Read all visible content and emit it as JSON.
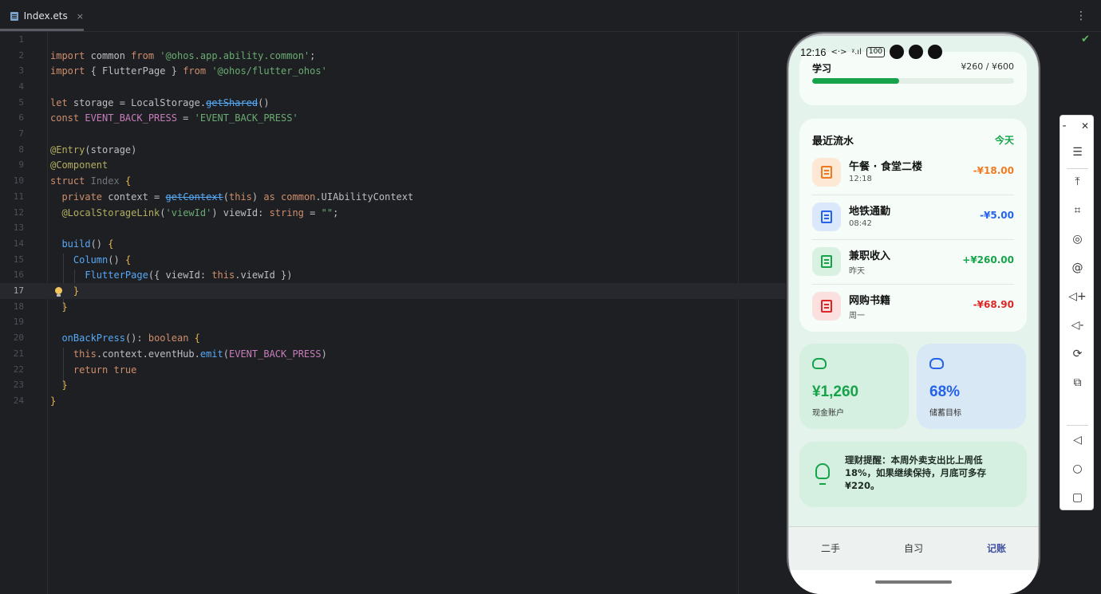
{
  "editor": {
    "tab_name": "Index.ets",
    "tab_close": "×",
    "menu_glyph": "⋮",
    "active_line": 17,
    "line_numbers": [
      "1",
      "2",
      "3",
      "4",
      "5",
      "6",
      "7",
      "8",
      "9",
      "10",
      "11",
      "12",
      "13",
      "14",
      "15",
      "16",
      "17",
      "18",
      "19",
      "20",
      "21",
      "22",
      "23",
      "24"
    ]
  },
  "phone": {
    "status": {
      "time": "12:16",
      "network": "<·>",
      "signal": "ᵡ.ıl",
      "battery": "100"
    },
    "budget": {
      "label": "学习",
      "value": "¥260 / ¥600",
      "progress": 0.43
    },
    "transactions": {
      "title": "最近流水",
      "filter": "今天",
      "items": [
        {
          "name": "午餐 · 食堂二楼",
          "sub": "12:18",
          "amount": "-¥18.00",
          "color": "#f07a20",
          "bg": "#fde8d6"
        },
        {
          "name": "地铁通勤",
          "sub": "08:42",
          "amount": "-¥5.00",
          "color": "#2563eb",
          "bg": "#dbe7fb"
        },
        {
          "name": "兼职收入",
          "sub": "昨天",
          "amount": "+¥260.00",
          "color": "#16a34a",
          "bg": "#d8f1e1"
        },
        {
          "name": "网购书籍",
          "sub": "周一",
          "amount": "-¥68.90",
          "color": "#dc2626",
          "bg": "#fbe0e0"
        }
      ]
    },
    "stats": [
      {
        "value": "¥1,260",
        "label": "现金账户",
        "color": "#16a34a",
        "bg": "#d5f0e0",
        "icon": "piggy-bank-icon"
      },
      {
        "value": "68%",
        "label": "储蓄目标",
        "color": "#2563eb",
        "bg": "#d8e8f5",
        "icon": "piggy-bank-icon"
      }
    ],
    "tip": {
      "text": "理财提醒：本周外卖支出比上周低18%，如果继续保持，月底可多存¥220。"
    },
    "nav": [
      {
        "label": "二手",
        "active": false
      },
      {
        "label": "自习",
        "active": false
      },
      {
        "label": "记账",
        "active": true
      }
    ]
  },
  "emulator_toolbar": {
    "minimize": "-",
    "close": "✕",
    "buttons": [
      "menu-icon",
      "pin-top-icon",
      "crop-icon",
      "rotate-icon",
      "at-icon",
      "volume-up-icon",
      "volume-down-icon",
      "rotate-device-icon",
      "multi-device-icon",
      "back-icon",
      "home-icon",
      "recents-icon"
    ]
  },
  "colors": {
    "accent_green": "#16a34a",
    "nav_active": "#3f4fa0",
    "editor_bg": "#1e1f22"
  }
}
